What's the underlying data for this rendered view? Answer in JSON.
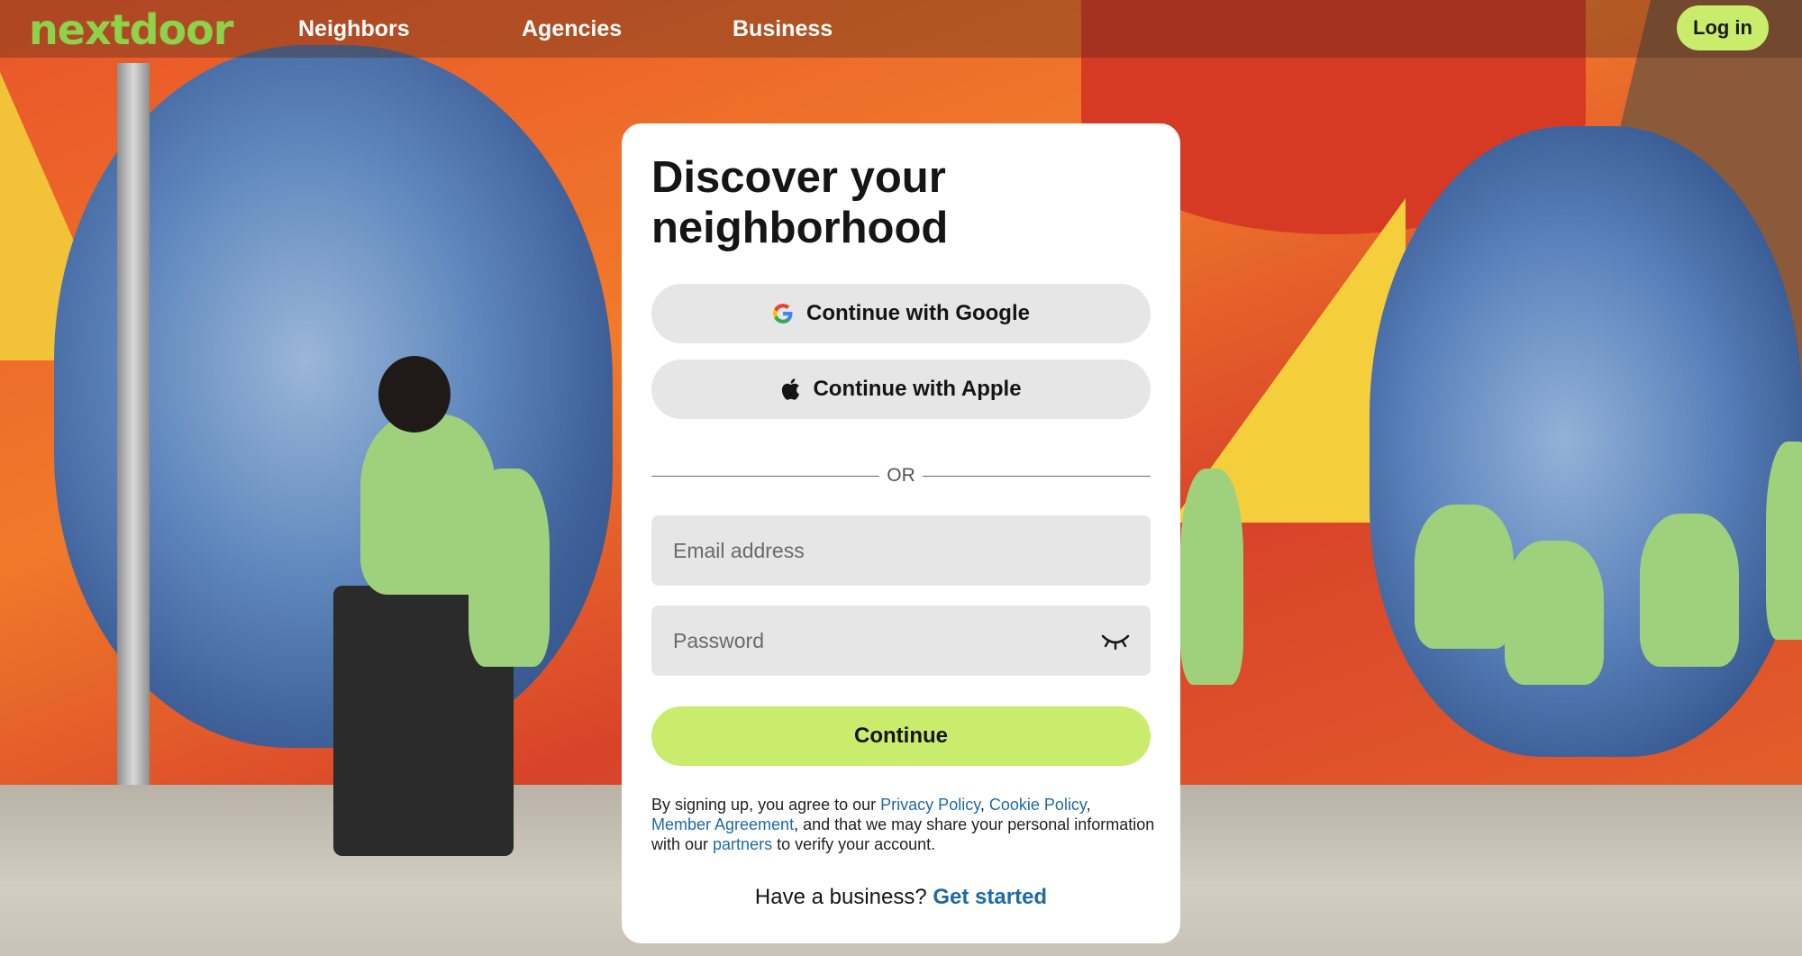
{
  "nav": {
    "logo": "nextdoor",
    "links": [
      "Neighbors",
      "Agencies",
      "Business"
    ],
    "login_label": "Log in"
  },
  "signup": {
    "headline": "Discover your neighborhood",
    "google_label": "Continue with Google",
    "apple_label": "Continue with Apple",
    "divider_text": "OR",
    "email_placeholder": "Email address",
    "password_placeholder": "Password",
    "continue_label": "Continue",
    "legal": {
      "t1": "By signing up, you agree to our ",
      "privacy": "Privacy Policy",
      "t2": ", ",
      "cookie": "Cookie Policy",
      "t3": ", ",
      "member": "Member Agreement",
      "t4": ", and that we may share your personal information with our ",
      "partners": "partners",
      "t5": " to verify your account."
    },
    "business_prompt": "Have a business?",
    "business_link": "Get started"
  },
  "icons": {
    "google": "google-logo-icon",
    "apple": "apple-logo-icon",
    "password_toggle": "eye-closed-icon"
  },
  "colors": {
    "brand_green": "#8ed14b",
    "accent_lime": "#c9ec6c",
    "link_blue": "#1f6aa5"
  }
}
